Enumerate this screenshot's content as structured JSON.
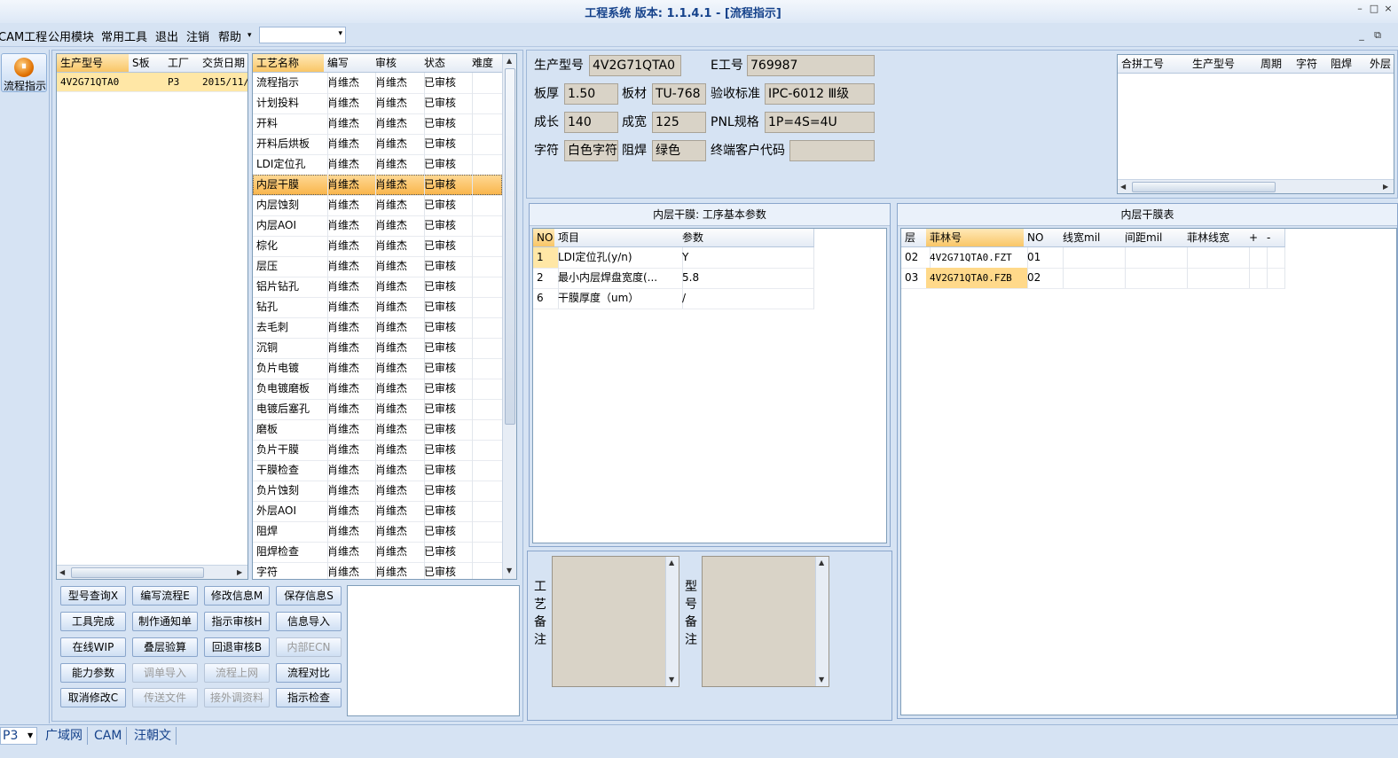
{
  "window": {
    "title": "工程系统  版本: 1.1.4.1 - [流程指示]",
    "min_glyph": "–",
    "max_glyph": "□",
    "close_glyph": "×",
    "child_min_glyph": "_",
    "child_restore_glyph": "⧉"
  },
  "menu": {
    "items": [
      "CAM工程",
      "公用模块",
      "常用工具",
      "退出",
      "注销",
      "帮助"
    ],
    "help_arrow": "▾",
    "combo_value": "",
    "combo_arrow": "▾"
  },
  "nav": {
    "flow_label": "流程指示",
    "icon": "flow-orb-icon"
  },
  "product_list": {
    "columns": [
      "生产型号",
      "S板",
      "工厂",
      "交货日期"
    ],
    "rows": [
      [
        "4V2G71QTA0",
        "",
        "P3",
        "2015/11/"
      ]
    ]
  },
  "process_list": {
    "columns": [
      "工艺名称",
      "编写",
      "审核",
      "状态",
      "难度"
    ],
    "selected_index": 5,
    "rows": [
      [
        "流程指示",
        "肖维杰",
        "肖维杰",
        "已审核",
        ""
      ],
      [
        "计划投料",
        "肖维杰",
        "肖维杰",
        "已审核",
        ""
      ],
      [
        "开料",
        "肖维杰",
        "肖维杰",
        "已审核",
        ""
      ],
      [
        "开料后烘板",
        "肖维杰",
        "肖维杰",
        "已审核",
        ""
      ],
      [
        "LDI定位孔",
        "肖维杰",
        "肖维杰",
        "已审核",
        ""
      ],
      [
        "内层干膜",
        "肖维杰",
        "肖维杰",
        "已审核",
        ""
      ],
      [
        "内层蚀刻",
        "肖维杰",
        "肖维杰",
        "已审核",
        ""
      ],
      [
        "内层AOI",
        "肖维杰",
        "肖维杰",
        "已审核",
        ""
      ],
      [
        "棕化",
        "肖维杰",
        "肖维杰",
        "已审核",
        ""
      ],
      [
        "层压",
        "肖维杰",
        "肖维杰",
        "已审核",
        ""
      ],
      [
        "铝片钻孔",
        "肖维杰",
        "肖维杰",
        "已审核",
        ""
      ],
      [
        "钻孔",
        "肖维杰",
        "肖维杰",
        "已审核",
        ""
      ],
      [
        "去毛刺",
        "肖维杰",
        "肖维杰",
        "已审核",
        ""
      ],
      [
        "沉铜",
        "肖维杰",
        "肖维杰",
        "已审核",
        ""
      ],
      [
        "负片电镀",
        "肖维杰",
        "肖维杰",
        "已审核",
        ""
      ],
      [
        "负电镀磨板",
        "肖维杰",
        "肖维杰",
        "已审核",
        ""
      ],
      [
        "电镀后塞孔",
        "肖维杰",
        "肖维杰",
        "已审核",
        ""
      ],
      [
        "磨板",
        "肖维杰",
        "肖维杰",
        "已审核",
        ""
      ],
      [
        "负片干膜",
        "肖维杰",
        "肖维杰",
        "已审核",
        ""
      ],
      [
        "干膜检查",
        "肖维杰",
        "肖维杰",
        "已审核",
        ""
      ],
      [
        "负片蚀刻",
        "肖维杰",
        "肖维杰",
        "已审核",
        ""
      ],
      [
        "外层AOI",
        "肖维杰",
        "肖维杰",
        "已审核",
        ""
      ],
      [
        "阻焊",
        "肖维杰",
        "肖维杰",
        "已审核",
        ""
      ],
      [
        "阻焊检查",
        "肖维杰",
        "肖维杰",
        "已审核",
        ""
      ],
      [
        "字符",
        "肖维杰",
        "肖维杰",
        "已审核",
        ""
      ]
    ]
  },
  "buttons": [
    {
      "label": "型号查询X",
      "enabled": true
    },
    {
      "label": "编写流程E",
      "enabled": true
    },
    {
      "label": "修改信息M",
      "enabled": true
    },
    {
      "label": "保存信息S",
      "enabled": true
    },
    {
      "label": "工具完成",
      "enabled": true
    },
    {
      "label": "制作通知单",
      "enabled": true
    },
    {
      "label": "指示审核H",
      "enabled": true
    },
    {
      "label": "信息导入",
      "enabled": true
    },
    {
      "label": "在线WIP",
      "enabled": true
    },
    {
      "label": "叠层验算",
      "enabled": true
    },
    {
      "label": "回退审核B",
      "enabled": true
    },
    {
      "label": "内部ECN",
      "enabled": false
    },
    {
      "label": "能力参数",
      "enabled": true
    },
    {
      "label": "调单导入",
      "enabled": false
    },
    {
      "label": "流程上网",
      "enabled": false
    },
    {
      "label": "流程对比",
      "enabled": true
    },
    {
      "label": "取消修改C",
      "enabled": true
    },
    {
      "label": "传送文件",
      "enabled": false
    },
    {
      "label": "接外调资料",
      "enabled": false
    },
    {
      "label": "指示检查",
      "enabled": true
    }
  ],
  "info": {
    "product_model_label": "生产型号",
    "product_model": "4V2G71QTA0",
    "e_no_label": "E工号",
    "e_no": "769987",
    "thickness_label": "板厚",
    "thickness": "1.50",
    "material_label": "板材",
    "material": "TU-768",
    "standard_label": "验收标准",
    "standard": "IPC-6012 Ⅲ级",
    "length_label": "成长",
    "length": "140",
    "width_label": "成宽",
    "width": "125",
    "pnl_label": "PNL规格",
    "pnl": "1P=4S=4U",
    "char_label": "字符",
    "char": "白色字符",
    "mask_label": "阻焊",
    "mask": "绿色",
    "customer_label": "终端客户代码",
    "customer": ""
  },
  "merge_grid": {
    "columns": [
      "合拼工号",
      "生产型号",
      "周期",
      "字符",
      "阻焊",
      "外层"
    ]
  },
  "params": {
    "title": "内层干膜: 工序基本参数",
    "columns": [
      "NO",
      "项目",
      "参数"
    ],
    "rows": [
      [
        "1",
        "LDI定位孔(y/n)",
        "Y"
      ],
      [
        "2",
        "最小内层焊盘宽度(...",
        "5.8"
      ],
      [
        "6",
        "干膜厚度（um）",
        "/"
      ]
    ]
  },
  "film": {
    "title": "内层干膜表",
    "columns": [
      "层",
      "菲林号",
      "NO",
      "线宽mil",
      "间距mil",
      "菲林线宽",
      "+",
      "-"
    ],
    "rows": [
      [
        "02",
        "4V2G71QTA0.FZT",
        "01",
        "",
        "",
        "",
        "",
        ""
      ],
      [
        "03",
        "4V2G71QTA0.FZB",
        "02",
        "",
        "",
        "",
        "",
        ""
      ]
    ]
  },
  "notes": {
    "process_label": "工艺备注",
    "model_label": "型号备注"
  },
  "status": {
    "combo": "P3",
    "tabs": [
      "广域网",
      "CAM",
      "汪朝文"
    ]
  }
}
